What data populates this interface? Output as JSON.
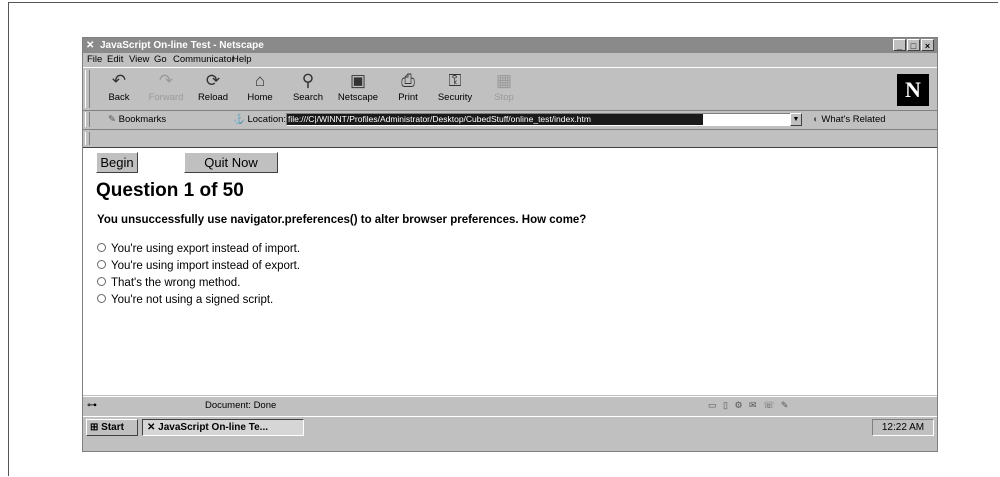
{
  "window": {
    "title": "JavaScript On-line Test - Netscape",
    "minimize": "_",
    "maximize": "□",
    "close": "×"
  },
  "menu": [
    "File",
    "Edit",
    "View",
    "Go",
    "Communicator",
    "Help"
  ],
  "toolbar": {
    "buttons": [
      {
        "label": "Back",
        "icon": "back-arrow-icon",
        "glyph": "↶",
        "enabled": true
      },
      {
        "label": "Forward",
        "icon": "forward-arrow-icon",
        "glyph": "↷",
        "enabled": false
      },
      {
        "label": "Reload",
        "icon": "reload-icon",
        "glyph": "⟳",
        "enabled": true
      },
      {
        "label": "Home",
        "icon": "home-icon",
        "glyph": "⌂",
        "enabled": true
      },
      {
        "label": "Search",
        "icon": "search-icon",
        "glyph": "⚲",
        "enabled": true
      },
      {
        "label": "Netscape",
        "icon": "netscape-icon",
        "glyph": "▣",
        "enabled": true
      },
      {
        "label": "Print",
        "icon": "print-icon",
        "glyph": "⎙",
        "enabled": true
      },
      {
        "label": "Security",
        "icon": "security-lock-icon",
        "glyph": "⚿",
        "enabled": true
      },
      {
        "label": "Stop",
        "icon": "stop-icon",
        "glyph": "▦",
        "enabled": false
      }
    ],
    "logo": "N"
  },
  "location": {
    "bookmarks_label": "Bookmarks",
    "location_label": "Location:",
    "url": "file:///C|/WINNT/Profiles/Administrator/Desktop/CubedStuff/online_test/index.htm",
    "related_label": "What's Related"
  },
  "content": {
    "begin_button": "Begin",
    "quit_button": "Quit Now",
    "question_title": "Question 1 of 50",
    "question_text": "You unsuccessfully use navigator.preferences() to alter browser preferences. How come?",
    "options": [
      "You're using export instead of import.",
      "You're using import instead of export.",
      "That's the wrong method.",
      "You're not using a signed script."
    ]
  },
  "status": {
    "text": "Document: Done"
  },
  "taskbar": {
    "start_label": "Start",
    "task_item": "JavaScript On-line Te...",
    "clock": "12:22 AM"
  }
}
